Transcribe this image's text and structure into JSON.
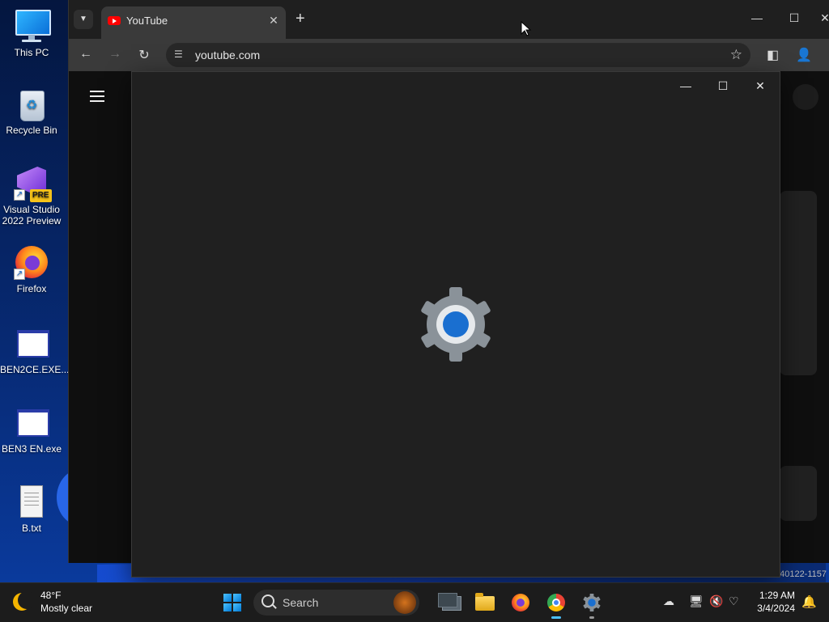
{
  "desktop": {
    "icons": [
      {
        "label": "This PC",
        "icon": "monitor-icon"
      },
      {
        "label": "Recycle Bin",
        "icon": "recycle-bin-icon"
      },
      {
        "label": "Visual Studio 2022 Preview",
        "icon": "visual-studio-icon",
        "badge": "PRE"
      },
      {
        "label": "Firefox",
        "icon": "firefox-icon"
      },
      {
        "label": "BEN2CE.EXE...",
        "icon": "exe-window-icon"
      },
      {
        "label": "BEN3 EN.exe",
        "icon": "exe-window-icon"
      },
      {
        "label": "B.txt",
        "icon": "text-file-icon"
      }
    ]
  },
  "browser": {
    "tab": {
      "title": "YouTube",
      "favicon": "youtube-icon"
    },
    "new_tab_symbol": "+",
    "address": {
      "url": "youtube.com"
    },
    "window_controls": {
      "minimize": "—",
      "maximize": "☐",
      "close": "✕"
    },
    "footer_code": "40122-1157"
  },
  "settings_window": {
    "icon": "settings-gear-icon",
    "controls": {
      "minimize": "—",
      "maximize": "☐",
      "close": "✕"
    }
  },
  "taskbar": {
    "weather": {
      "temp": "48°F",
      "condition": "Mostly clear"
    },
    "search": {
      "placeholder": "Search"
    },
    "apps": [
      {
        "name": "task-view"
      },
      {
        "name": "file-explorer"
      },
      {
        "name": "firefox"
      },
      {
        "name": "chrome",
        "state": "active"
      },
      {
        "name": "settings",
        "state": "running"
      }
    ],
    "clock": {
      "time": "1:29 AM",
      "date": "3/4/2024"
    }
  },
  "colors": {
    "settings_bg": "#202020",
    "gear_gray": "#8a9299",
    "gear_blue": "#1a6fd0",
    "accent": "#4cc2ff"
  }
}
